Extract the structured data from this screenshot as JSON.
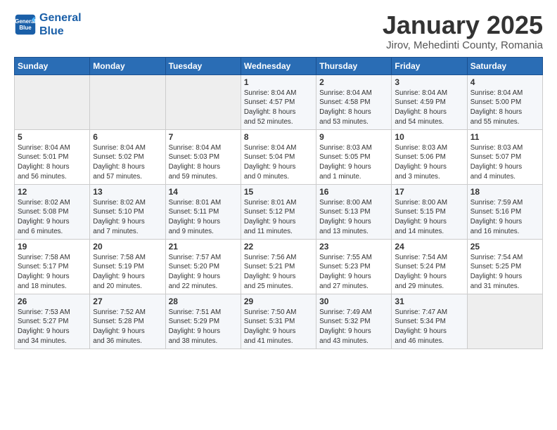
{
  "header": {
    "logo_line1": "General",
    "logo_line2": "Blue",
    "title": "January 2025",
    "subtitle": "Jirov, Mehedinti County, Romania"
  },
  "days_of_week": [
    "Sunday",
    "Monday",
    "Tuesday",
    "Wednesday",
    "Thursday",
    "Friday",
    "Saturday"
  ],
  "weeks": [
    [
      {
        "day": "",
        "info": ""
      },
      {
        "day": "",
        "info": ""
      },
      {
        "day": "",
        "info": ""
      },
      {
        "day": "1",
        "info": "Sunrise: 8:04 AM\nSunset: 4:57 PM\nDaylight: 8 hours\nand 52 minutes."
      },
      {
        "day": "2",
        "info": "Sunrise: 8:04 AM\nSunset: 4:58 PM\nDaylight: 8 hours\nand 53 minutes."
      },
      {
        "day": "3",
        "info": "Sunrise: 8:04 AM\nSunset: 4:59 PM\nDaylight: 8 hours\nand 54 minutes."
      },
      {
        "day": "4",
        "info": "Sunrise: 8:04 AM\nSunset: 5:00 PM\nDaylight: 8 hours\nand 55 minutes."
      }
    ],
    [
      {
        "day": "5",
        "info": "Sunrise: 8:04 AM\nSunset: 5:01 PM\nDaylight: 8 hours\nand 56 minutes."
      },
      {
        "day": "6",
        "info": "Sunrise: 8:04 AM\nSunset: 5:02 PM\nDaylight: 8 hours\nand 57 minutes."
      },
      {
        "day": "7",
        "info": "Sunrise: 8:04 AM\nSunset: 5:03 PM\nDaylight: 8 hours\nand 59 minutes."
      },
      {
        "day": "8",
        "info": "Sunrise: 8:04 AM\nSunset: 5:04 PM\nDaylight: 9 hours\nand 0 minutes."
      },
      {
        "day": "9",
        "info": "Sunrise: 8:03 AM\nSunset: 5:05 PM\nDaylight: 9 hours\nand 1 minute."
      },
      {
        "day": "10",
        "info": "Sunrise: 8:03 AM\nSunset: 5:06 PM\nDaylight: 9 hours\nand 3 minutes."
      },
      {
        "day": "11",
        "info": "Sunrise: 8:03 AM\nSunset: 5:07 PM\nDaylight: 9 hours\nand 4 minutes."
      }
    ],
    [
      {
        "day": "12",
        "info": "Sunrise: 8:02 AM\nSunset: 5:08 PM\nDaylight: 9 hours\nand 6 minutes."
      },
      {
        "day": "13",
        "info": "Sunrise: 8:02 AM\nSunset: 5:10 PM\nDaylight: 9 hours\nand 7 minutes."
      },
      {
        "day": "14",
        "info": "Sunrise: 8:01 AM\nSunset: 5:11 PM\nDaylight: 9 hours\nand 9 minutes."
      },
      {
        "day": "15",
        "info": "Sunrise: 8:01 AM\nSunset: 5:12 PM\nDaylight: 9 hours\nand 11 minutes."
      },
      {
        "day": "16",
        "info": "Sunrise: 8:00 AM\nSunset: 5:13 PM\nDaylight: 9 hours\nand 13 minutes."
      },
      {
        "day": "17",
        "info": "Sunrise: 8:00 AM\nSunset: 5:15 PM\nDaylight: 9 hours\nand 14 minutes."
      },
      {
        "day": "18",
        "info": "Sunrise: 7:59 AM\nSunset: 5:16 PM\nDaylight: 9 hours\nand 16 minutes."
      }
    ],
    [
      {
        "day": "19",
        "info": "Sunrise: 7:58 AM\nSunset: 5:17 PM\nDaylight: 9 hours\nand 18 minutes."
      },
      {
        "day": "20",
        "info": "Sunrise: 7:58 AM\nSunset: 5:19 PM\nDaylight: 9 hours\nand 20 minutes."
      },
      {
        "day": "21",
        "info": "Sunrise: 7:57 AM\nSunset: 5:20 PM\nDaylight: 9 hours\nand 22 minutes."
      },
      {
        "day": "22",
        "info": "Sunrise: 7:56 AM\nSunset: 5:21 PM\nDaylight: 9 hours\nand 25 minutes."
      },
      {
        "day": "23",
        "info": "Sunrise: 7:55 AM\nSunset: 5:23 PM\nDaylight: 9 hours\nand 27 minutes."
      },
      {
        "day": "24",
        "info": "Sunrise: 7:54 AM\nSunset: 5:24 PM\nDaylight: 9 hours\nand 29 minutes."
      },
      {
        "day": "25",
        "info": "Sunrise: 7:54 AM\nSunset: 5:25 PM\nDaylight: 9 hours\nand 31 minutes."
      }
    ],
    [
      {
        "day": "26",
        "info": "Sunrise: 7:53 AM\nSunset: 5:27 PM\nDaylight: 9 hours\nand 34 minutes."
      },
      {
        "day": "27",
        "info": "Sunrise: 7:52 AM\nSunset: 5:28 PM\nDaylight: 9 hours\nand 36 minutes."
      },
      {
        "day": "28",
        "info": "Sunrise: 7:51 AM\nSunset: 5:29 PM\nDaylight: 9 hours\nand 38 minutes."
      },
      {
        "day": "29",
        "info": "Sunrise: 7:50 AM\nSunset: 5:31 PM\nDaylight: 9 hours\nand 41 minutes."
      },
      {
        "day": "30",
        "info": "Sunrise: 7:49 AM\nSunset: 5:32 PM\nDaylight: 9 hours\nand 43 minutes."
      },
      {
        "day": "31",
        "info": "Sunrise: 7:47 AM\nSunset: 5:34 PM\nDaylight: 9 hours\nand 46 minutes."
      },
      {
        "day": "",
        "info": ""
      }
    ]
  ]
}
